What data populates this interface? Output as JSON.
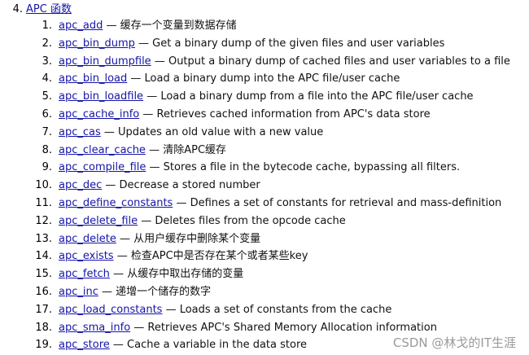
{
  "section": {
    "number": "4.",
    "title": "APC 函数"
  },
  "items": [
    {
      "num": "1.",
      "name": "apc_add",
      "desc": "— 缓存一个变量到数据存储"
    },
    {
      "num": "2.",
      "name": "apc_bin_dump",
      "desc": "— Get a binary dump of the given files and user variables"
    },
    {
      "num": "3.",
      "name": "apc_bin_dumpfile",
      "desc": "— Output a binary dump of cached files and user variables to a file"
    },
    {
      "num": "4.",
      "name": "apc_bin_load",
      "desc": "— Load a binary dump into the APC file/user cache"
    },
    {
      "num": "5.",
      "name": "apc_bin_loadfile",
      "desc": "— Load a binary dump from a file into the APC file/user cache"
    },
    {
      "num": "6.",
      "name": "apc_cache_info",
      "desc": "— Retrieves cached information from APC's data store"
    },
    {
      "num": "7.",
      "name": "apc_cas",
      "desc": "— Updates an old value with a new value"
    },
    {
      "num": "8.",
      "name": "apc_clear_cache",
      "desc": "— 清除APC缓存"
    },
    {
      "num": "9.",
      "name": "apc_compile_file",
      "desc": "— Stores a file in the bytecode cache, bypassing all filters."
    },
    {
      "num": "10.",
      "name": "apc_dec",
      "desc": "— Decrease a stored number"
    },
    {
      "num": "11.",
      "name": "apc_define_constants",
      "desc": "— Defines a set of constants for retrieval and mass-definition"
    },
    {
      "num": "12.",
      "name": "apc_delete_file",
      "desc": "— Deletes files from the opcode cache"
    },
    {
      "num": "13.",
      "name": "apc_delete",
      "desc": "— 从用户缓存中删除某个变量"
    },
    {
      "num": "14.",
      "name": "apc_exists",
      "desc": "— 检查APC中是否存在某个或者某些key"
    },
    {
      "num": "15.",
      "name": "apc_fetch",
      "desc": "— 从缓存中取出存储的变量"
    },
    {
      "num": "16.",
      "name": "apc_inc",
      "desc": "— 递增一个储存的数字"
    },
    {
      "num": "17.",
      "name": "apc_load_constants",
      "desc": "— Loads a set of constants from the cache"
    },
    {
      "num": "18.",
      "name": "apc_sma_info",
      "desc": "— Retrieves APC's Shared Memory Allocation information"
    },
    {
      "num": "19.",
      "name": "apc_store",
      "desc": "— Cache a variable in the data store"
    }
  ],
  "watermark": "CSDN @林戈的IT生涯",
  "colors": {
    "link": "#1515a8",
    "text": "#111111",
    "watermark": "#9a9a9a"
  }
}
